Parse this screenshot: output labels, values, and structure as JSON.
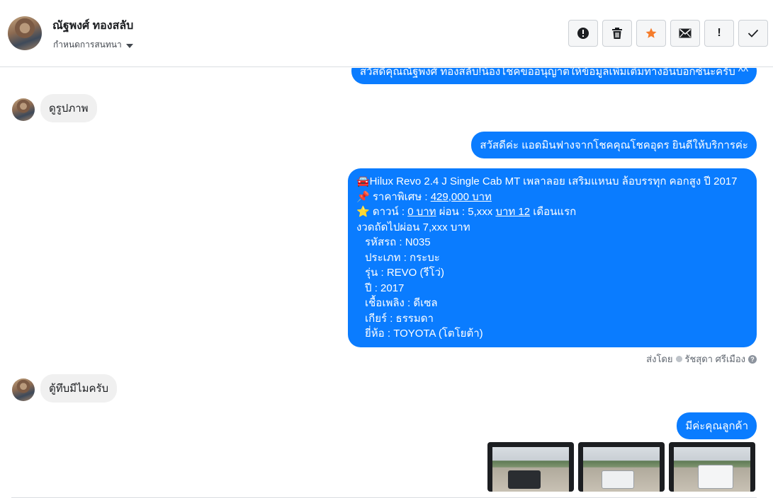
{
  "header": {
    "contact_name": "ณัฐพงศ์ ทองสลับ",
    "assign_label": "กำหนดการสนทนา",
    "actions": [
      {
        "name": "report-icon",
        "label": ""
      },
      {
        "name": "trash-icon",
        "label": ""
      },
      {
        "name": "star-icon",
        "label": ""
      },
      {
        "name": "mail-icon",
        "label": ""
      },
      {
        "name": "follow-up",
        "label": "!"
      },
      {
        "name": "done-check-icon",
        "label": ""
      }
    ]
  },
  "messages": {
    "m1": "สวัสดีคุณณัฐพงศ์ ทองสลับ!น้องโชคขออนุญาตให้ข้อมูลเพิ่มเติมทางอินบ็อกซ์นะครับ ^^",
    "m2": "ดูรูปภาพ",
    "m3": "สวัสดีค่ะ แอดมินฟางจากโชคคุณโชคอุดร ยินดีให้บริการค่ะ",
    "m4": {
      "line1": "🚘Hilux Revo 2.4 J Single Cab MT เพลาลอย เสริมแหนบ ล้อบรรทุก คอกสูง ปี 2017",
      "price_prefix": "📌 ราคาพิเศษ : ",
      "price": "429,000 บาท",
      "down_prefix": "⭐ ดาวน์ : ",
      "down": "0 บาท",
      "installment_mid": " ผ่อน : 5,xxx ",
      "installment_u": "บาท 12",
      "installment_suffix": " เดือนแรก",
      "next_installment": "งวดถัดไปผ่อน  7,xxx บาท",
      "code": "รหัสรถ : N035",
      "type": "ประเภท : กระบะ",
      "model": "รุ่น : REVO (รีโว่)",
      "year": "ปี : 2017",
      "fuel": "เชื้อเพลิง : ดีเซล",
      "gear": "เกียร์ : ธรรมดา",
      "brand": "ยี่ห้อ : TOYOTA (โตโยต้า)"
    },
    "sent_by_prefix": "ส่งโดย",
    "sent_by_name": "รัชสุดา ศรีเมือง",
    "m5": "ตู้ทึบมีไมครับ",
    "m6": "มีค่ะคุณลูกค้า"
  },
  "colors": {
    "outgoing_bubble": "#0a7cff",
    "incoming_bubble": "#f0f0f0",
    "star": "#f57c2b"
  },
  "photos": [
    {
      "name": "photo-truck-black"
    },
    {
      "name": "photo-truck-white-cab"
    },
    {
      "name": "photo-truck-box"
    }
  ]
}
